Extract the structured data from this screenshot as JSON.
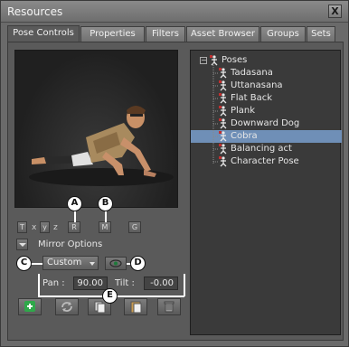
{
  "window": {
    "title": "Resources",
    "close_label": "X"
  },
  "tabs": [
    "Pose Controls",
    "Properties",
    "Filters",
    "Asset Browser",
    "Groups",
    "Sets"
  ],
  "active_tab": "Pose Controls",
  "tree": {
    "root": "Poses",
    "items": [
      "Tadasana",
      "Uttanasana",
      "Flat Back",
      "Plank",
      "Downward Dog",
      "Cobra",
      "Balancing act",
      "Character Pose"
    ],
    "selected": "Cobra",
    "selected_color": "#6f8fb7"
  },
  "axis_buttons": {
    "t": "T",
    "x": "x",
    "y": "y",
    "z": "z",
    "r": "R",
    "m": "M",
    "g": "G"
  },
  "mirror": {
    "label": "Mirror Options"
  },
  "mirror_select": {
    "value": "Custom"
  },
  "pan": {
    "label": "Pan :",
    "value": "90.00"
  },
  "tilt": {
    "label": "Tilt :",
    "value": "-0.00"
  },
  "callouts": {
    "a": "A",
    "b": "B",
    "c": "C",
    "d": "D",
    "e": "E"
  },
  "icons": {
    "add": "plus-icon",
    "refresh": "refresh-icon",
    "copy": "copy-icon",
    "paste": "paste-icon",
    "delete": "trash-icon",
    "eye": "eye-icon",
    "pose": "pose-figure-icon"
  },
  "colors": {
    "panel": "#5a5a5a",
    "tree_bg": "#3a3a3a",
    "add_green": "#2fa84a"
  }
}
